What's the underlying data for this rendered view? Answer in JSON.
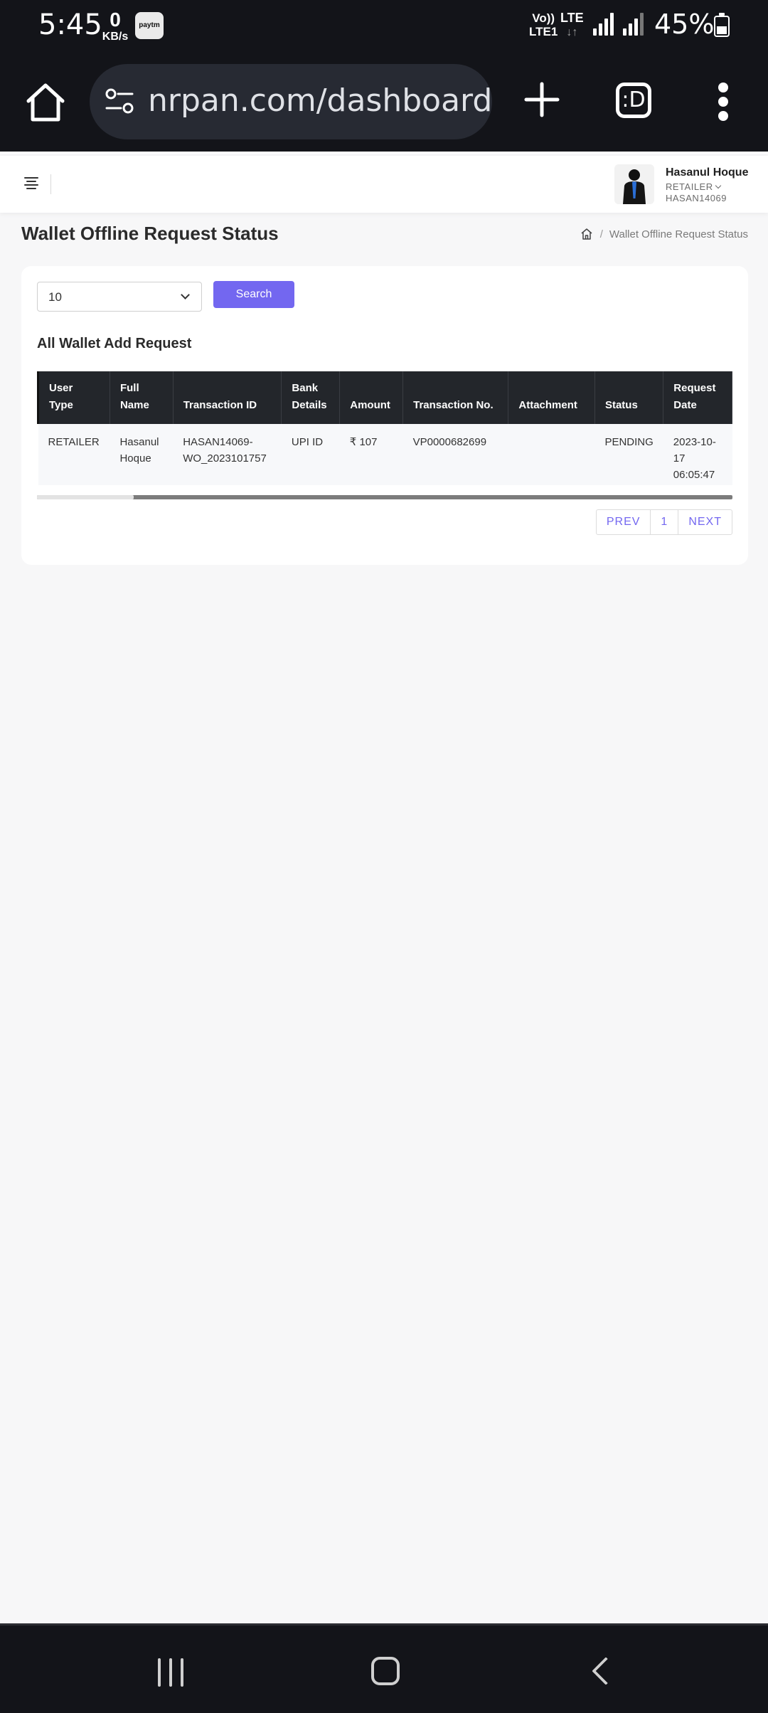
{
  "status_bar": {
    "time": "5:45",
    "net_speed_value": "0",
    "net_speed_unit": "KB/s",
    "paytm_label": "paytm",
    "volte_line1": "Vo))",
    "volte_line2": "LTE1",
    "lte_label": "LTE",
    "lte_arrows": "↓↑",
    "battery_percent": "45%"
  },
  "browser": {
    "url": "nrpan.com/dashboard/wallet-offline-request-status",
    "tabs_label": ":D"
  },
  "header": {
    "user_name": "Hasanul Hoque",
    "user_role": "RETAILER",
    "user_id": "HASAN14069"
  },
  "page": {
    "title": "Wallet Offline Request Status",
    "breadcrumb_current": "Wallet Offline Request Status",
    "breadcrumb_separator": "/"
  },
  "filters": {
    "page_size": "10",
    "search_label": "Search"
  },
  "table": {
    "title": "All Wallet Add Request",
    "columns": [
      "User Type",
      "Full Name",
      "Transaction ID",
      "Bank Details",
      "Amount",
      "Transaction No.",
      "Attachment",
      "Status",
      "Request Date"
    ],
    "rows": [
      {
        "user_type": "RETAILER",
        "full_name": "Hasanul Hoque",
        "transaction_id": "HASAN14069-WO_2023101757",
        "bank_details": "UPI ID",
        "amount": "₹ 107",
        "transaction_no": "VP0000682699",
        "attachment": "",
        "status": "PENDING",
        "request_date": "2023-10-17 06:05:47"
      }
    ]
  },
  "pagination": {
    "prev_label": "PREV",
    "page": "1",
    "next_label": "NEXT"
  },
  "colors": {
    "accent": "#7367f0",
    "table_header_bg": "#23262b",
    "system_bar_bg": "#131419"
  }
}
